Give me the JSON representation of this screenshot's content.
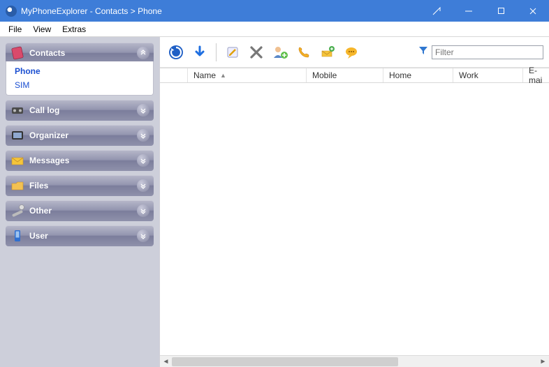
{
  "window": {
    "title": "MyPhoneExplorer -   Contacts > Phone"
  },
  "menu": {
    "file": "File",
    "view": "View",
    "extras": "Extras"
  },
  "sidebar": {
    "groups": [
      {
        "label": "Contacts",
        "expanded": true,
        "items": [
          {
            "label": "Phone",
            "active": true
          },
          {
            "label": "SIM",
            "active": false
          }
        ]
      },
      {
        "label": "Call log"
      },
      {
        "label": "Organizer"
      },
      {
        "label": "Messages"
      },
      {
        "label": "Files"
      },
      {
        "label": "Other"
      },
      {
        "label": "User"
      }
    ]
  },
  "toolbar": {
    "filter_placeholder": "Filter"
  },
  "table": {
    "columns": {
      "name": "Name",
      "mobile": "Mobile",
      "home": "Home",
      "work": "Work",
      "email": "E-mai"
    },
    "rows": []
  }
}
